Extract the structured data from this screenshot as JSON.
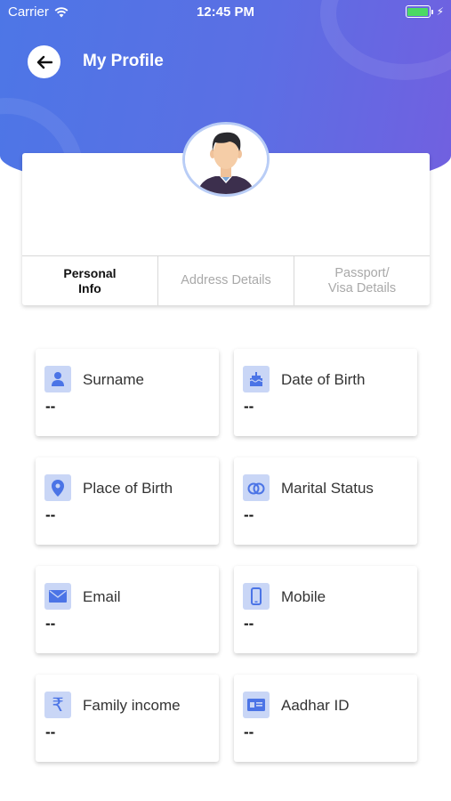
{
  "status_bar": {
    "carrier": "Carrier",
    "time": "12:45 PM",
    "battery_level": 1.0
  },
  "nav": {
    "title": "My Profile",
    "back_icon": "arrow-left-icon"
  },
  "profile": {
    "avatar_icon": "user-avatar-icon",
    "tabs": [
      {
        "label": "Personal\nInfo",
        "active": true
      },
      {
        "label": "Address Details",
        "active": false
      },
      {
        "label": "Passport/\nVisa Details",
        "active": false
      }
    ]
  },
  "fields": [
    {
      "label": "Surname",
      "value": "--",
      "icon": "person-icon"
    },
    {
      "label": "Date of Birth",
      "value": "--",
      "icon": "birthday-cake-icon"
    },
    {
      "label": "Place of Birth",
      "value": "--",
      "icon": "location-pin-icon"
    },
    {
      "label": "Marital Status",
      "value": "--",
      "icon": "rings-icon"
    },
    {
      "label": "Email",
      "value": "--",
      "icon": "envelope-icon"
    },
    {
      "label": "Mobile",
      "value": "--",
      "icon": "mobile-phone-icon"
    },
    {
      "label": "Family income",
      "value": "--",
      "icon": "rupee-icon"
    },
    {
      "label": "Aadhar ID",
      "value": "--",
      "icon": "id-card-icon"
    }
  ],
  "colors": {
    "accent": "#5b6fe4",
    "icon_bg": "#c9d6f6",
    "icon_fg": "#4b74e6"
  }
}
